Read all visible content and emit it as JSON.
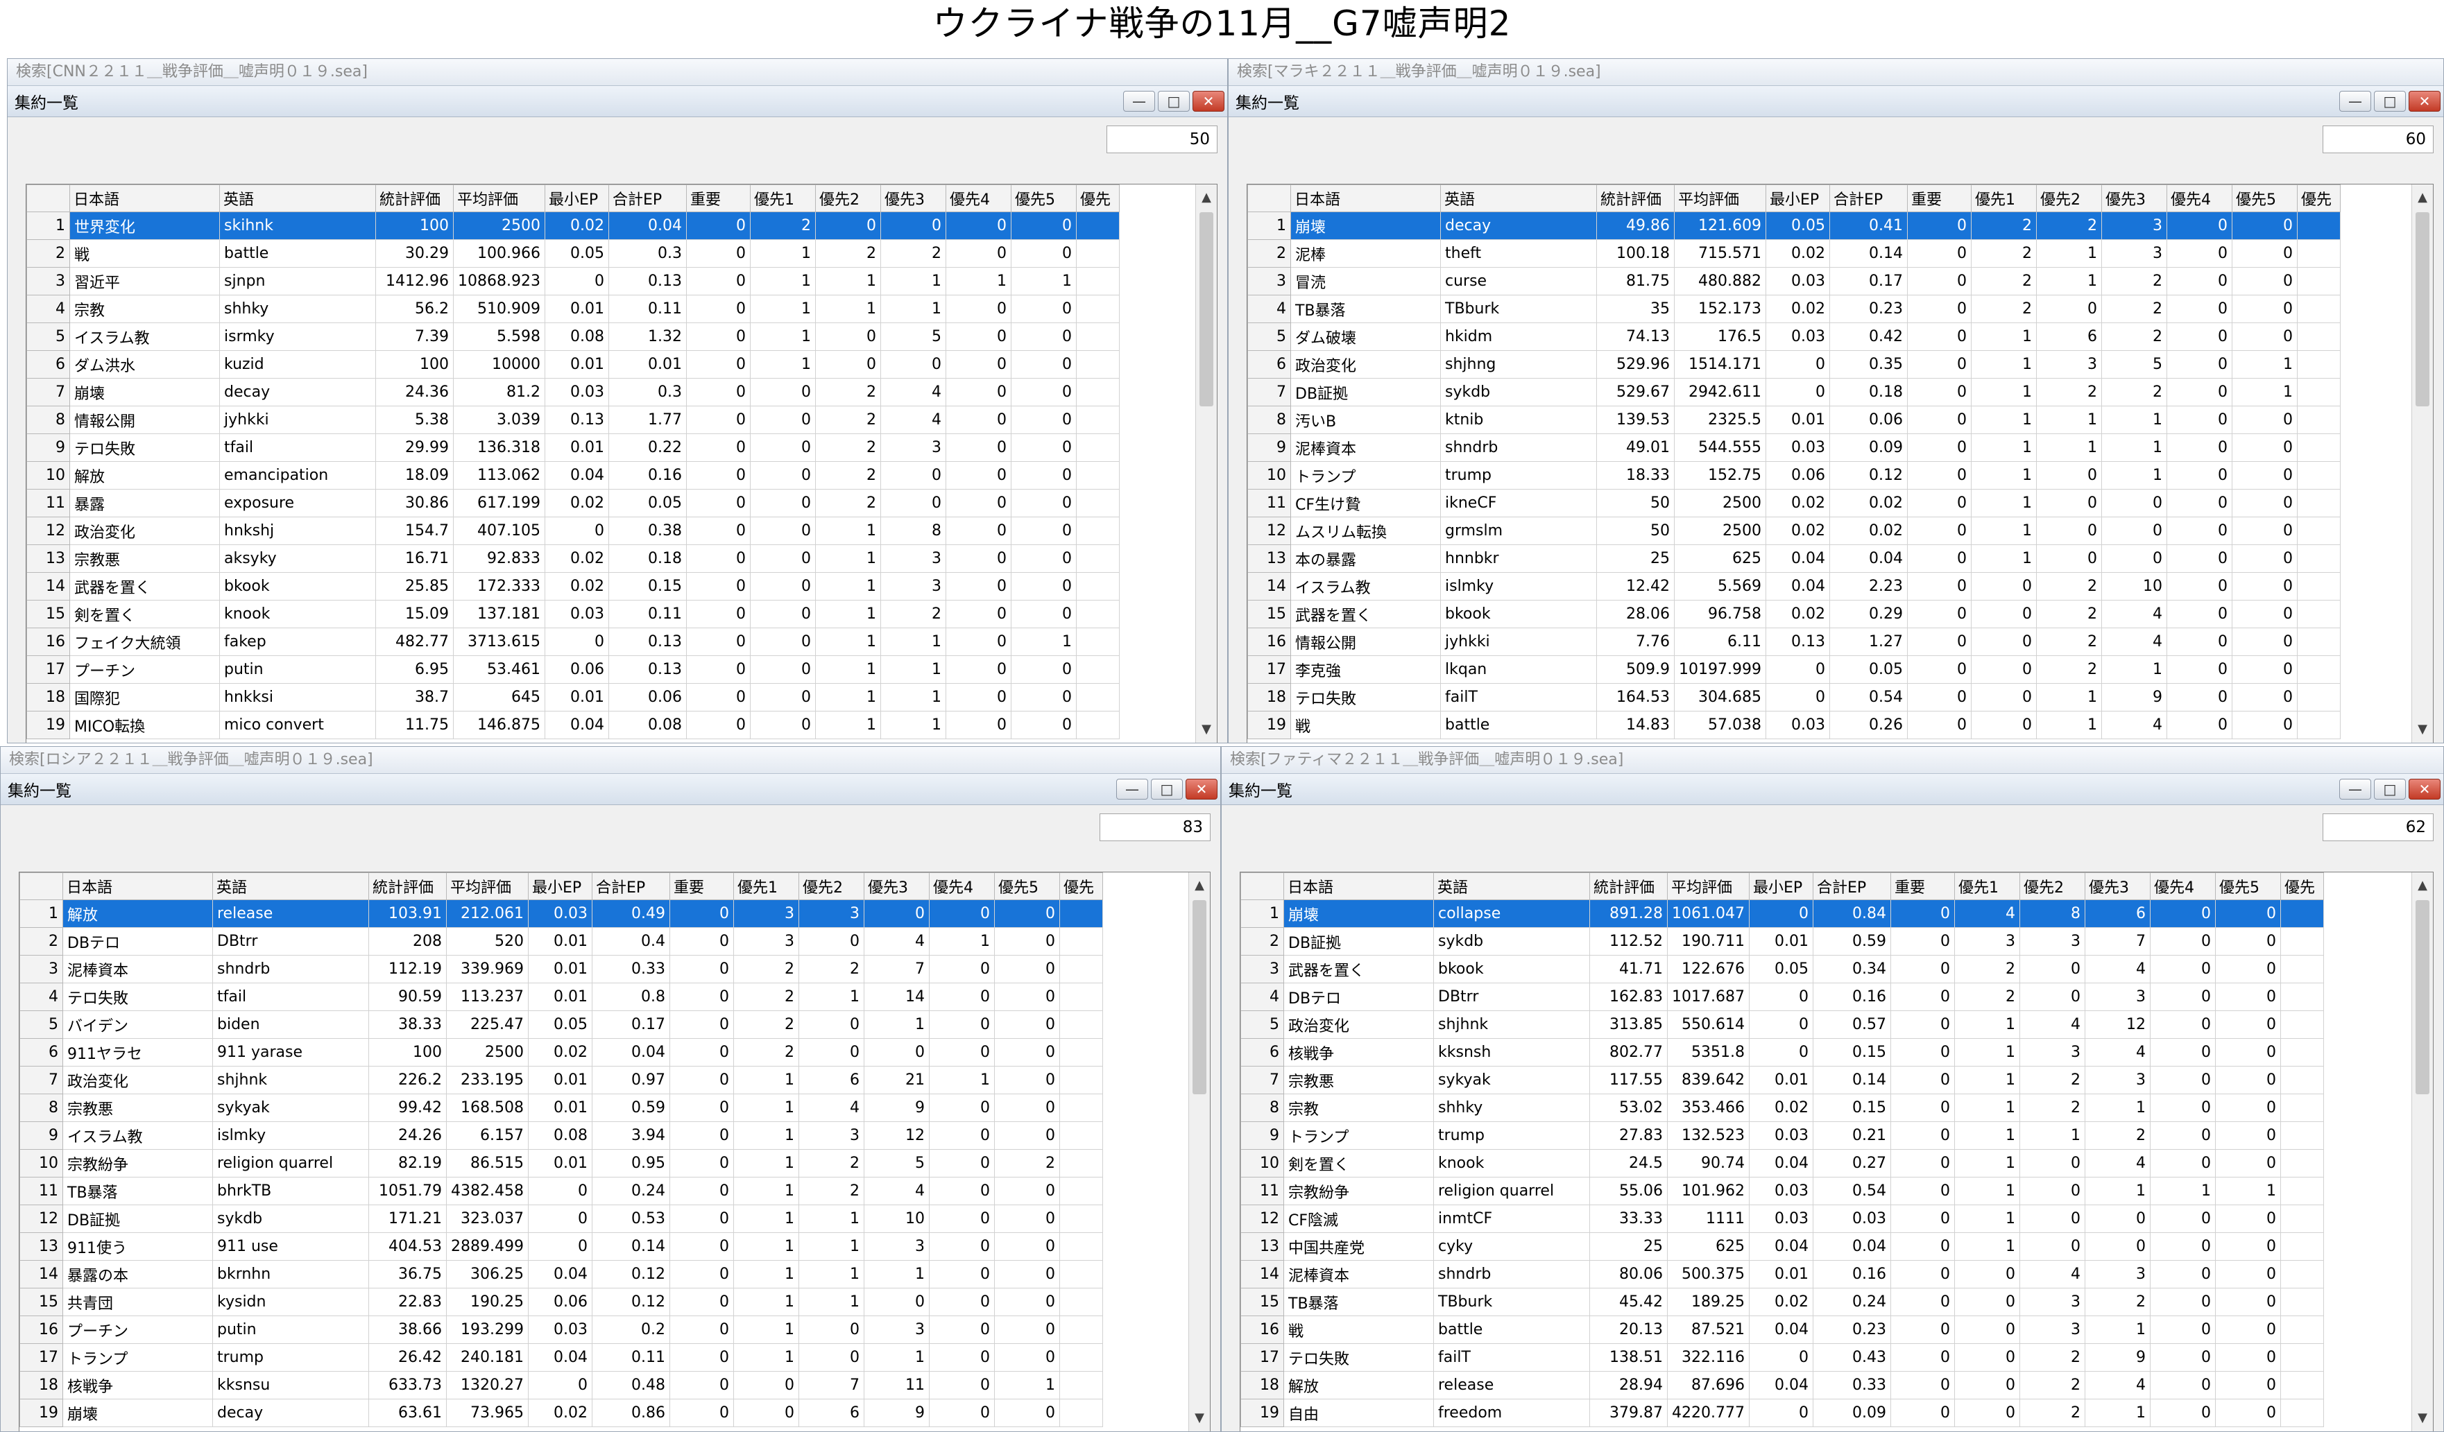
{
  "page_title": "ウクライナ戦争の11月__G7嘘声明2",
  "columns": [
    "",
    "日本語",
    "英語",
    "統計評価",
    "平均評価",
    "最小EP",
    "合計EP",
    "重要",
    "優先1",
    "優先2",
    "優先3",
    "優先4",
    "優先5",
    "優先"
  ],
  "inner_title": "集約一覧",
  "panels": [
    {
      "outer_title": "検索[CNN２２１１＿戦争評価＿嘘声明０１９.sea]",
      "count": "50",
      "rows": [
        [
          "1",
          "世界変化",
          "skihnk",
          "100",
          "2500",
          "0.02",
          "0.04",
          "0",
          "2",
          "0",
          "0",
          "0",
          "0"
        ],
        [
          "2",
          "戦",
          "battle",
          "30.29",
          "100.966",
          "0.05",
          "0.3",
          "0",
          "1",
          "2",
          "2",
          "0",
          "0"
        ],
        [
          "3",
          "習近平",
          "sjnpn",
          "1412.96",
          "10868.923",
          "0",
          "0.13",
          "0",
          "1",
          "1",
          "1",
          "1",
          "1"
        ],
        [
          "4",
          "宗教",
          "shhky",
          "56.2",
          "510.909",
          "0.01",
          "0.11",
          "0",
          "1",
          "1",
          "1",
          "0",
          "0"
        ],
        [
          "5",
          "イスラム教",
          "isrmky",
          "7.39",
          "5.598",
          "0.08",
          "1.32",
          "0",
          "1",
          "0",
          "5",
          "0",
          "0"
        ],
        [
          "6",
          "ダム洪水",
          "kuzid",
          "100",
          "10000",
          "0.01",
          "0.01",
          "0",
          "1",
          "0",
          "0",
          "0",
          "0"
        ],
        [
          "7",
          "崩壊",
          "decay",
          "24.36",
          "81.2",
          "0.03",
          "0.3",
          "0",
          "0",
          "2",
          "4",
          "0",
          "0"
        ],
        [
          "8",
          "情報公開",
          "jyhkki",
          "5.38",
          "3.039",
          "0.13",
          "1.77",
          "0",
          "0",
          "2",
          "4",
          "0",
          "0"
        ],
        [
          "9",
          "テロ失敗",
          "tfail",
          "29.99",
          "136.318",
          "0.01",
          "0.22",
          "0",
          "0",
          "2",
          "3",
          "0",
          "0"
        ],
        [
          "10",
          "解放",
          "emancipation",
          "18.09",
          "113.062",
          "0.04",
          "0.16",
          "0",
          "0",
          "2",
          "0",
          "0",
          "0"
        ],
        [
          "11",
          "暴露",
          "exposure",
          "30.86",
          "617.199",
          "0.02",
          "0.05",
          "0",
          "0",
          "2",
          "0",
          "0",
          "0"
        ],
        [
          "12",
          "政治変化",
          "hnkshj",
          "154.7",
          "407.105",
          "0",
          "0.38",
          "0",
          "0",
          "1",
          "8",
          "0",
          "0"
        ],
        [
          "13",
          "宗教悪",
          "aksyky",
          "16.71",
          "92.833",
          "0.02",
          "0.18",
          "0",
          "0",
          "1",
          "3",
          "0",
          "0"
        ],
        [
          "14",
          "武器を置く",
          "bkook",
          "25.85",
          "172.333",
          "0.02",
          "0.15",
          "0",
          "0",
          "1",
          "3",
          "0",
          "0"
        ],
        [
          "15",
          "剣を置く",
          "knook",
          "15.09",
          "137.181",
          "0.03",
          "0.11",
          "0",
          "0",
          "1",
          "2",
          "0",
          "0"
        ],
        [
          "16",
          "フェイク大統領",
          "fakep",
          "482.77",
          "3713.615",
          "0",
          "0.13",
          "0",
          "0",
          "1",
          "1",
          "0",
          "1"
        ],
        [
          "17",
          "プーチン",
          "putin",
          "6.95",
          "53.461",
          "0.06",
          "0.13",
          "0",
          "0",
          "1",
          "1",
          "0",
          "0"
        ],
        [
          "18",
          "国際犯",
          "hnkksi",
          "38.7",
          "645",
          "0.01",
          "0.06",
          "0",
          "0",
          "1",
          "1",
          "0",
          "0"
        ],
        [
          "19",
          "MICO転換",
          "mico convert",
          "11.75",
          "146.875",
          "0.04",
          "0.08",
          "0",
          "0",
          "1",
          "1",
          "0",
          "0"
        ]
      ]
    },
    {
      "outer_title": "検索[マラキ２２１１＿戦争評価＿嘘声明０１９.sea]",
      "count": "60",
      "rows": [
        [
          "1",
          "崩壊",
          "decay",
          "49.86",
          "121.609",
          "0.05",
          "0.41",
          "0",
          "2",
          "2",
          "3",
          "0",
          "0"
        ],
        [
          "2",
          "泥棒",
          "theft",
          "100.18",
          "715.571",
          "0.02",
          "0.14",
          "0",
          "2",
          "1",
          "3",
          "0",
          "0"
        ],
        [
          "3",
          "冒涜",
          "curse",
          "81.75",
          "480.882",
          "0.03",
          "0.17",
          "0",
          "2",
          "1",
          "2",
          "0",
          "0"
        ],
        [
          "4",
          "TB暴落",
          "TBburk",
          "35",
          "152.173",
          "0.02",
          "0.23",
          "0",
          "2",
          "0",
          "2",
          "0",
          "0"
        ],
        [
          "5",
          "ダム破壊",
          "hkidm",
          "74.13",
          "176.5",
          "0.03",
          "0.42",
          "0",
          "1",
          "6",
          "2",
          "0",
          "0"
        ],
        [
          "6",
          "政治変化",
          "shjhng",
          "529.96",
          "1514.171",
          "0",
          "0.35",
          "0",
          "1",
          "3",
          "5",
          "0",
          "1"
        ],
        [
          "7",
          "DB証拠",
          "sykdb",
          "529.67",
          "2942.611",
          "0",
          "0.18",
          "0",
          "1",
          "2",
          "2",
          "0",
          "1"
        ],
        [
          "8",
          "汚いB",
          "ktnib",
          "139.53",
          "2325.5",
          "0.01",
          "0.06",
          "0",
          "1",
          "1",
          "1",
          "0",
          "0"
        ],
        [
          "9",
          "泥棒資本",
          "shndrb",
          "49.01",
          "544.555",
          "0.03",
          "0.09",
          "0",
          "1",
          "1",
          "1",
          "0",
          "0"
        ],
        [
          "10",
          "トランプ",
          "trump",
          "18.33",
          "152.75",
          "0.06",
          "0.12",
          "0",
          "1",
          "0",
          "1",
          "0",
          "0"
        ],
        [
          "11",
          "CF生け贄",
          "ikneCF",
          "50",
          "2500",
          "0.02",
          "0.02",
          "0",
          "1",
          "0",
          "0",
          "0",
          "0"
        ],
        [
          "12",
          "ムスリム転換",
          "grmslm",
          "50",
          "2500",
          "0.02",
          "0.02",
          "0",
          "1",
          "0",
          "0",
          "0",
          "0"
        ],
        [
          "13",
          "本の暴露",
          "hnnbkr",
          "25",
          "625",
          "0.04",
          "0.04",
          "0",
          "1",
          "0",
          "0",
          "0",
          "0"
        ],
        [
          "14",
          "イスラム教",
          "islmky",
          "12.42",
          "5.569",
          "0.04",
          "2.23",
          "0",
          "0",
          "2",
          "10",
          "0",
          "0"
        ],
        [
          "15",
          "武器を置く",
          "bkook",
          "28.06",
          "96.758",
          "0.02",
          "0.29",
          "0",
          "0",
          "2",
          "4",
          "0",
          "0"
        ],
        [
          "16",
          "情報公開",
          "jyhkki",
          "7.76",
          "6.11",
          "0.13",
          "1.27",
          "0",
          "0",
          "2",
          "4",
          "0",
          "0"
        ],
        [
          "17",
          "李克強",
          "lkqan",
          "509.9",
          "10197.999",
          "0",
          "0.05",
          "0",
          "0",
          "2",
          "1",
          "0",
          "0"
        ],
        [
          "18",
          "テロ失敗",
          "failT",
          "164.53",
          "304.685",
          "0",
          "0.54",
          "0",
          "0",
          "1",
          "9",
          "0",
          "0"
        ],
        [
          "19",
          "戦",
          "battle",
          "14.83",
          "57.038",
          "0.03",
          "0.26",
          "0",
          "0",
          "1",
          "4",
          "0",
          "0"
        ]
      ]
    },
    {
      "outer_title": "検索[ロシア２２１１＿戦争評価＿嘘声明０１９.sea]",
      "count": "83",
      "rows": [
        [
          "1",
          "解放",
          "release",
          "103.91",
          "212.061",
          "0.03",
          "0.49",
          "0",
          "3",
          "3",
          "0",
          "0",
          "0"
        ],
        [
          "2",
          "DBテロ",
          "DBtrr",
          "208",
          "520",
          "0.01",
          "0.4",
          "0",
          "3",
          "0",
          "4",
          "1",
          "0"
        ],
        [
          "3",
          "泥棒資本",
          "shndrb",
          "112.19",
          "339.969",
          "0.01",
          "0.33",
          "0",
          "2",
          "2",
          "7",
          "0",
          "0"
        ],
        [
          "4",
          "テロ失敗",
          "tfail",
          "90.59",
          "113.237",
          "0.01",
          "0.8",
          "0",
          "2",
          "1",
          "14",
          "0",
          "0"
        ],
        [
          "5",
          "バイデン",
          "biden",
          "38.33",
          "225.47",
          "0.05",
          "0.17",
          "0",
          "2",
          "0",
          "1",
          "0",
          "0"
        ],
        [
          "6",
          "911ヤラセ",
          "911 yarase",
          "100",
          "2500",
          "0.02",
          "0.04",
          "0",
          "2",
          "0",
          "0",
          "0",
          "0"
        ],
        [
          "7",
          "政治変化",
          "shjhnk",
          "226.2",
          "233.195",
          "0.01",
          "0.97",
          "0",
          "1",
          "6",
          "21",
          "1",
          "0"
        ],
        [
          "8",
          "宗教悪",
          "sykyak",
          "99.42",
          "168.508",
          "0.01",
          "0.59",
          "0",
          "1",
          "4",
          "9",
          "0",
          "0"
        ],
        [
          "9",
          "イスラム教",
          "islmky",
          "24.26",
          "6.157",
          "0.08",
          "3.94",
          "0",
          "1",
          "3",
          "12",
          "0",
          "0"
        ],
        [
          "10",
          "宗教紛争",
          "religion quarrel",
          "82.19",
          "86.515",
          "0.01",
          "0.95",
          "0",
          "1",
          "2",
          "5",
          "0",
          "2"
        ],
        [
          "11",
          "TB暴落",
          "bhrkTB",
          "1051.79",
          "4382.458",
          "0",
          "0.24",
          "0",
          "1",
          "2",
          "4",
          "0",
          "0"
        ],
        [
          "12",
          "DB証拠",
          "sykdb",
          "171.21",
          "323.037",
          "0",
          "0.53",
          "0",
          "1",
          "1",
          "10",
          "0",
          "0"
        ],
        [
          "13",
          "911使う",
          "911 use",
          "404.53",
          "2889.499",
          "0",
          "0.14",
          "0",
          "1",
          "1",
          "3",
          "0",
          "0"
        ],
        [
          "14",
          "暴露の本",
          "bkrnhn",
          "36.75",
          "306.25",
          "0.04",
          "0.12",
          "0",
          "1",
          "1",
          "1",
          "0",
          "0"
        ],
        [
          "15",
          "共青団",
          "kysidn",
          "22.83",
          "190.25",
          "0.06",
          "0.12",
          "0",
          "1",
          "1",
          "0",
          "0",
          "0"
        ],
        [
          "16",
          "プーチン",
          "putin",
          "38.66",
          "193.299",
          "0.03",
          "0.2",
          "0",
          "1",
          "0",
          "3",
          "0",
          "0"
        ],
        [
          "17",
          "トランプ",
          "trump",
          "26.42",
          "240.181",
          "0.04",
          "0.11",
          "0",
          "1",
          "0",
          "1",
          "0",
          "0"
        ],
        [
          "18",
          "核戦争",
          "kksnsu",
          "633.73",
          "1320.27",
          "0",
          "0.48",
          "0",
          "0",
          "7",
          "11",
          "0",
          "1"
        ],
        [
          "19",
          "崩壊",
          "decay",
          "63.61",
          "73.965",
          "0.02",
          "0.86",
          "0",
          "0",
          "6",
          "9",
          "0",
          "0"
        ]
      ]
    },
    {
      "outer_title": "検索[ファティマ２２１１＿戦争評価＿嘘声明０１９.sea]",
      "count": "62",
      "rows": [
        [
          "1",
          "崩壊",
          "collapse",
          "891.28",
          "1061.047",
          "0",
          "0.84",
          "0",
          "4",
          "8",
          "6",
          "0",
          "0"
        ],
        [
          "2",
          "DB証拠",
          "sykdb",
          "112.52",
          "190.711",
          "0.01",
          "0.59",
          "0",
          "3",
          "3",
          "7",
          "0",
          "0"
        ],
        [
          "3",
          "武器を置く",
          "bkook",
          "41.71",
          "122.676",
          "0.05",
          "0.34",
          "0",
          "2",
          "0",
          "4",
          "0",
          "0"
        ],
        [
          "4",
          "DBテロ",
          "DBtrr",
          "162.83",
          "1017.687",
          "0",
          "0.16",
          "0",
          "2",
          "0",
          "3",
          "0",
          "0"
        ],
        [
          "5",
          "政治変化",
          "shjhnk",
          "313.85",
          "550.614",
          "0",
          "0.57",
          "0",
          "1",
          "4",
          "12",
          "0",
          "0"
        ],
        [
          "6",
          "核戦争",
          "kksnsh",
          "802.77",
          "5351.8",
          "0",
          "0.15",
          "0",
          "1",
          "3",
          "4",
          "0",
          "0"
        ],
        [
          "7",
          "宗教悪",
          "sykyak",
          "117.55",
          "839.642",
          "0.01",
          "0.14",
          "0",
          "1",
          "2",
          "3",
          "0",
          "0"
        ],
        [
          "8",
          "宗教",
          "shhky",
          "53.02",
          "353.466",
          "0.02",
          "0.15",
          "0",
          "1",
          "2",
          "1",
          "0",
          "0"
        ],
        [
          "9",
          "トランプ",
          "trump",
          "27.83",
          "132.523",
          "0.03",
          "0.21",
          "0",
          "1",
          "1",
          "2",
          "0",
          "0"
        ],
        [
          "10",
          "剣を置く",
          "knook",
          "24.5",
          "90.74",
          "0.04",
          "0.27",
          "0",
          "1",
          "0",
          "4",
          "0",
          "0"
        ],
        [
          "11",
          "宗教紛争",
          "religion quarrel",
          "55.06",
          "101.962",
          "0.03",
          "0.54",
          "0",
          "1",
          "0",
          "1",
          "1",
          "1"
        ],
        [
          "12",
          "CF陰滅",
          "inmtCF",
          "33.33",
          "1111",
          "0.03",
          "0.03",
          "0",
          "1",
          "0",
          "0",
          "0",
          "0"
        ],
        [
          "13",
          "中国共産党",
          "cyky",
          "25",
          "625",
          "0.04",
          "0.04",
          "0",
          "1",
          "0",
          "0",
          "0",
          "0"
        ],
        [
          "14",
          "泥棒資本",
          "shndrb",
          "80.06",
          "500.375",
          "0.01",
          "0.16",
          "0",
          "0",
          "4",
          "3",
          "0",
          "0"
        ],
        [
          "15",
          "TB暴落",
          "TBburk",
          "45.42",
          "189.25",
          "0.02",
          "0.24",
          "0",
          "0",
          "3",
          "2",
          "0",
          "0"
        ],
        [
          "16",
          "戦",
          "battle",
          "20.13",
          "87.521",
          "0.04",
          "0.23",
          "0",
          "0",
          "3",
          "1",
          "0",
          "0"
        ],
        [
          "17",
          "テロ失敗",
          "failT",
          "138.51",
          "322.116",
          "0",
          "0.43",
          "0",
          "0",
          "2",
          "9",
          "0",
          "0"
        ],
        [
          "18",
          "解放",
          "release",
          "28.94",
          "87.696",
          "0.04",
          "0.33",
          "0",
          "0",
          "2",
          "4",
          "0",
          "0"
        ],
        [
          "19",
          "自由",
          "freedom",
          "379.87",
          "4220.777",
          "0",
          "0.09",
          "0",
          "0",
          "2",
          "1",
          "0",
          "0"
        ]
      ]
    }
  ]
}
